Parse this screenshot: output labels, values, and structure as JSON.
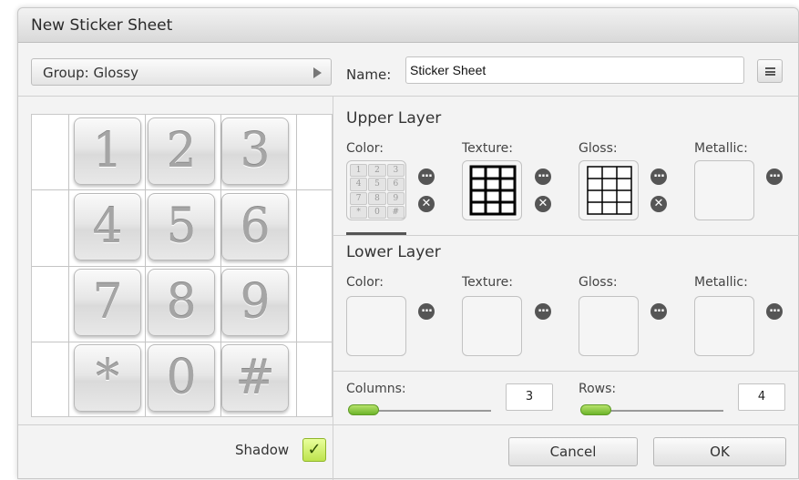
{
  "dialog": {
    "title": "New Sticker Sheet"
  },
  "group_select": {
    "label": "Group: Glossy"
  },
  "name": {
    "label": "Name:",
    "value": "Sticker Sheet"
  },
  "preview": {
    "keys": [
      "1",
      "2",
      "3",
      "4",
      "5",
      "6",
      "7",
      "8",
      "9",
      "*",
      "0",
      "#"
    ]
  },
  "upper_layer": {
    "title": "Upper Layer",
    "slots": [
      {
        "label": "Color:"
      },
      {
        "label": "Texture:"
      },
      {
        "label": "Gloss:"
      },
      {
        "label": "Metallic:"
      }
    ],
    "color_thumbnail_keys": [
      "1",
      "2",
      "3",
      "4",
      "5",
      "6",
      "7",
      "8",
      "9",
      "*",
      "0",
      "#"
    ]
  },
  "lower_layer": {
    "title": "Lower Layer",
    "slots": [
      {
        "label": "Color:"
      },
      {
        "label": "Texture:"
      },
      {
        "label": "Gloss:"
      },
      {
        "label": "Metallic:"
      }
    ]
  },
  "columns": {
    "label": "Columns:",
    "value": "3"
  },
  "rows": {
    "label": "Rows:",
    "value": "4"
  },
  "shadow": {
    "label": "Shadow",
    "checked": true,
    "check_glyph": "✓"
  },
  "buttons": {
    "cancel": "Cancel",
    "ok": "OK"
  },
  "icons": {
    "more": "more-options-icon",
    "clear": "clear-icon"
  },
  "colors": {
    "accent_green": "#bde34e",
    "icon_dark": "#555555"
  }
}
